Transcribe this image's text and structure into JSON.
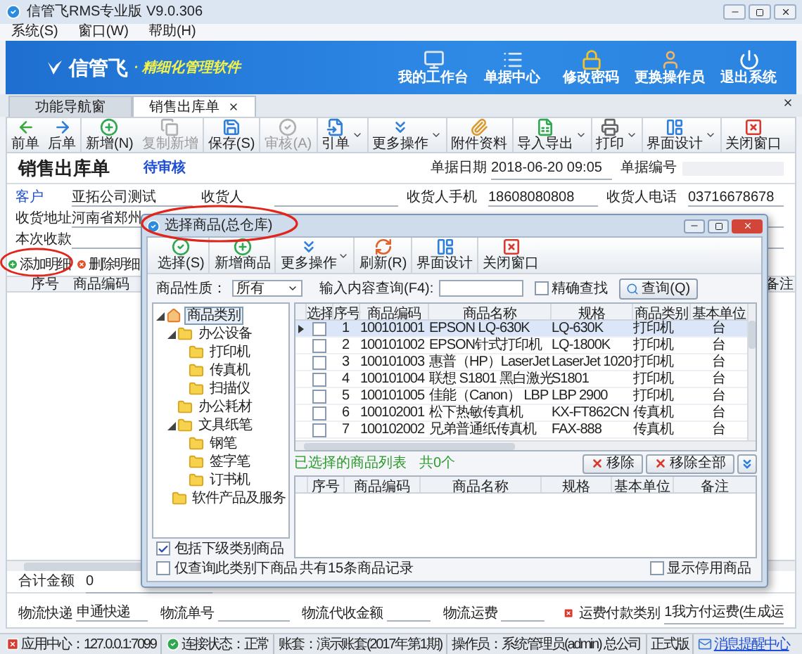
{
  "window": {
    "title": "信管飞RMS专业版 V9.0.306"
  },
  "menu": [
    "系统(S)",
    "窗口(W)",
    "帮助(H)"
  ],
  "banner": {
    "logo": "信管飞",
    "slogan": "· 精细化管理软件",
    "actions": [
      {
        "kind": "monitor",
        "label": "我的工作台"
      },
      {
        "kind": "list",
        "label": "单据中心"
      },
      {
        "kind": "lock",
        "label": "修改密码"
      },
      {
        "kind": "user",
        "label": "更换操作员"
      },
      {
        "kind": "power",
        "label": "退出系统"
      }
    ]
  },
  "tabs": [
    {
      "label": "功能导航窗",
      "selected": false,
      "closable": false
    },
    {
      "label": "销售出库单",
      "selected": true,
      "closable": true
    }
  ],
  "toolbar_groups": [
    [
      {
        "kind": "prev",
        "label": "前单",
        "disabled": false,
        "dropdown": false
      },
      {
        "kind": "next",
        "label": "后单",
        "disabled": false,
        "dropdown": false
      }
    ],
    [
      {
        "kind": "add",
        "label": "新增(N)",
        "disabled": false,
        "dropdown": false
      },
      {
        "kind": "copy",
        "label": "复制新增",
        "disabled": true,
        "dropdown": false
      }
    ],
    [
      {
        "kind": "save",
        "label": "保存(S)",
        "disabled": false,
        "dropdown": false
      }
    ],
    [
      {
        "kind": "audit",
        "label": "审核(A)",
        "disabled": true,
        "dropdown": false
      }
    ],
    [
      {
        "kind": "reference",
        "label": "引单",
        "disabled": false,
        "dropdown": true
      }
    ],
    [
      {
        "kind": "more",
        "label": "更多操作",
        "disabled": false,
        "dropdown": true
      }
    ],
    [
      {
        "kind": "attach",
        "label": "附件资料",
        "disabled": false,
        "dropdown": false
      }
    ],
    [
      {
        "kind": "io",
        "label": "导入导出",
        "disabled": false,
        "dropdown": true
      }
    ],
    [
      {
        "kind": "print",
        "label": "打印",
        "disabled": false,
        "dropdown": true
      }
    ],
    [
      {
        "kind": "layout",
        "label": "界面设计",
        "disabled": false,
        "dropdown": true
      }
    ],
    [
      {
        "kind": "close",
        "label": "关闭窗口",
        "disabled": false,
        "dropdown": false
      }
    ]
  ],
  "document": {
    "title": "销售出库单",
    "status": "待审核",
    "date_label": "单据日期",
    "date": "2018-06-20 09:05",
    "number_label": "单据编号"
  },
  "field_rows": [
    [
      {
        "label": "客户",
        "value": "亚拓公司测试",
        "link": true
      },
      {
        "label": "收货人",
        "link": false
      },
      {
        "label": "收货人手机",
        "value": "18608080808",
        "link": false
      },
      {
        "label": "收货人电话",
        "value": "03716678678",
        "link": false
      }
    ],
    [
      {
        "label": "收货地址",
        "value": "河南省郑州",
        "link": false
      }
    ],
    [
      {
        "label": "本次收款",
        "link": false
      }
    ]
  ],
  "detail_toolbar": [
    {
      "kind": "add",
      "label": "添加明细"
    },
    {
      "kind": "delete",
      "label": "删除明细"
    }
  ],
  "detail_columns": [
    "序号",
    "商品编码",
    "备注"
  ],
  "totals": {
    "label": "合计金额",
    "value": "0"
  },
  "logistics": [
    {
      "kind": "field",
      "label": "物流快递",
      "value": "申通快递"
    },
    {
      "kind": "field",
      "label": "物流单号"
    },
    {
      "kind": "field",
      "label": "物流代收金额"
    },
    {
      "kind": "field",
      "label": "物流运费"
    },
    {
      "kind": "flagged",
      "label": "运费付款类别",
      "value": "1我方付运费(生成运"
    }
  ],
  "status_bar": [
    {
      "kind": "app",
      "text": "应用中心：127.0.0.1:7099"
    },
    {
      "kind": "connection",
      "text": "连接状态：正常"
    },
    {
      "kind": "plain",
      "text": "账套：演示账套(2017年第1期)"
    },
    {
      "kind": "plain",
      "text": "操作员：系统管理员(admin) 总公司"
    },
    {
      "kind": "plain",
      "text": "正式版"
    },
    {
      "kind": "message",
      "text": "消息提醒中心"
    }
  ],
  "dialog": {
    "title": "选择商品(总仓库)",
    "toolbar": [
      {
        "kind": "select",
        "label": "选择(S)",
        "dropdown": false
      },
      {
        "kind": "add",
        "label": "新增商品",
        "dropdown": false
      },
      {
        "kind": "more",
        "label": "更多操作",
        "dropdown": true
      },
      {
        "kind": "refresh",
        "label": "刷新(R)",
        "dropdown": false
      },
      {
        "kind": "layout",
        "label": "界面设计",
        "dropdown": false
      },
      {
        "kind": "close",
        "label": "关闭窗口",
        "dropdown": false
      }
    ],
    "filter": {
      "label": "商品性质：",
      "value": "所有",
      "search_label": "输入内容查询(F4):",
      "exact_label": "精确查找",
      "exact_checked": false,
      "query_button": "查询(Q)"
    },
    "tree": [
      {
        "label": "商品类别",
        "kind": "root",
        "selected": true,
        "expanded": true,
        "children": [
          {
            "label": "办公设备",
            "kind": "folder",
            "selected": false,
            "expanded": true,
            "children": [
              {
                "label": "打印机",
                "kind": "folder",
                "selected": false
              },
              {
                "label": "传真机",
                "kind": "folder",
                "selected": false
              },
              {
                "label": "扫描仪",
                "kind": "folder",
                "selected": false
              }
            ]
          },
          {
            "label": "办公耗材",
            "kind": "folder",
            "selected": false
          },
          {
            "label": "文具纸笔",
            "kind": "folder",
            "selected": false,
            "expanded": true,
            "children": [
              {
                "label": "钢笔",
                "kind": "folder",
                "selected": false
              },
              {
                "label": "签字笔",
                "kind": "folder",
                "selected": false
              },
              {
                "label": "订书机",
                "kind": "folder",
                "selected": false
              }
            ]
          },
          {
            "label": "软件产品及服务",
            "kind": "folder",
            "selected": false
          }
        ]
      }
    ],
    "tree_options": [
      {
        "label": "包括下级类别商品",
        "checked": true
      },
      {
        "label": "仅查询此类别下商品",
        "checked": false
      }
    ],
    "select_column": "选择",
    "columns": [
      "序号",
      "商品编码",
      "商品名称",
      "规格",
      "商品类别",
      "基本单位"
    ],
    "rows": [
      {
        "selected": true,
        "checked": false,
        "cells": [
          "1",
          "100101001",
          "EPSON LQ-630K",
          "LQ-630K",
          "打印机",
          "台"
        ]
      },
      {
        "selected": false,
        "checked": false,
        "cells": [
          "2",
          "100101002",
          "EPSON针式打印机",
          "LQ-1800K",
          "打印机",
          "台"
        ]
      },
      {
        "selected": false,
        "checked": false,
        "cells": [
          "3",
          "100101003",
          "惠普（HP）LaserJet",
          "LaserJet 1020",
          "打印机",
          "台"
        ]
      },
      {
        "selected": false,
        "checked": false,
        "cells": [
          "4",
          "100101004",
          "联想 S1801 黑白激光",
          "S1801",
          "打印机",
          "台"
        ]
      },
      {
        "selected": false,
        "checked": false,
        "cells": [
          "5",
          "100101005",
          "佳能（Canon） LBP",
          "LBP 2900",
          "打印机",
          "台"
        ]
      },
      {
        "selected": false,
        "checked": false,
        "cells": [
          "6",
          "100102001",
          "松下热敏传真机",
          "KX-FT862CN",
          "传真机",
          "台"
        ]
      },
      {
        "selected": false,
        "checked": false,
        "cells": [
          "7",
          "100102002",
          "兄弟普通纸传真机",
          "FAX-888",
          "传真机",
          "台"
        ]
      }
    ],
    "selected_title": "已选择的商品列表",
    "selected_count": "共0个",
    "remove_buttons": [
      "移除",
      "移除全部"
    ],
    "selected_columns": [
      "序号",
      "商品编码",
      "商品名称",
      "规格",
      "基本单位",
      "备注"
    ],
    "record_count": "共有15条商品记录",
    "show_disabled": {
      "label": "显示停用商品",
      "checked": false
    }
  }
}
